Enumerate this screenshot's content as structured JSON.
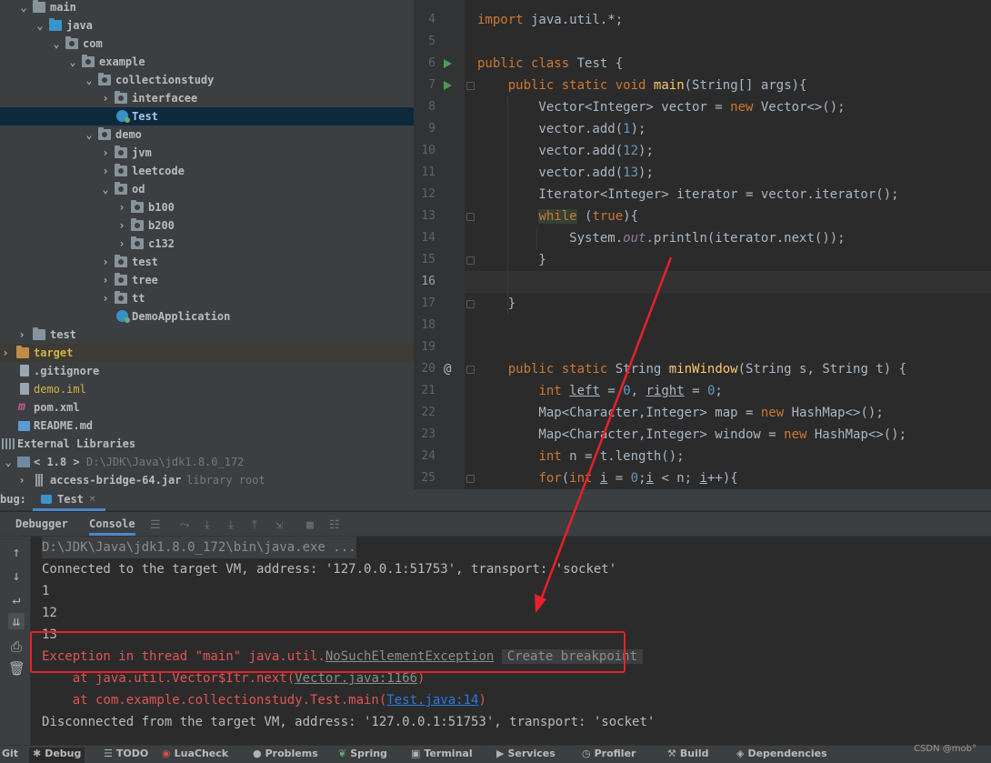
{
  "tree": {
    "rows": [
      {
        "label": "main"
      },
      {
        "label": "java"
      },
      {
        "label": "com"
      },
      {
        "label": "example"
      },
      {
        "label": "collectionstudy"
      },
      {
        "label": "interfacee"
      },
      {
        "label": "Test"
      },
      {
        "label": "demo"
      },
      {
        "label": "jvm"
      },
      {
        "label": "leetcode"
      },
      {
        "label": "od"
      },
      {
        "label": "b100"
      },
      {
        "label": "b200"
      },
      {
        "label": "c132"
      },
      {
        "label": "test"
      },
      {
        "label": "tree"
      },
      {
        "label": "tt"
      },
      {
        "label": "DemoApplication"
      },
      {
        "label": "test"
      },
      {
        "label": "target"
      },
      {
        "label": ".gitignore"
      },
      {
        "label": "demo.iml"
      },
      {
        "label": "pom.xml"
      },
      {
        "label": "README.md"
      },
      {
        "label": "External Libraries"
      },
      {
        "label": "< 1.8 >",
        "hint": "D:\\JDK\\Java\\jdk1.8.0_172"
      },
      {
        "label": "access-bridge-64.jar",
        "hint": "library root"
      }
    ],
    "selected": "Test",
    "excluded_folder": "target"
  },
  "editor": {
    "line_numbers": [
      "4",
      "5",
      "6",
      "7",
      "8",
      "9",
      "10",
      "11",
      "12",
      "13",
      "14",
      "15",
      "16",
      "17",
      "18",
      "19",
      "20",
      "21",
      "22",
      "23",
      "24",
      "25"
    ],
    "current_line": "16",
    "lines": [
      "import java.util.*;",
      "",
      "public class Test {",
      "    public static void main(String[] args){",
      "        Vector<Integer> vector = new Vector<>();",
      "        vector.add(1);",
      "        vector.add(12);",
      "        vector.add(13);",
      "        Iterator<Integer> iterator = vector.iterator();",
      "        while (true){",
      "            System.out.println(iterator.next());",
      "        }",
      "",
      "    }",
      "",
      "",
      "    public static String minWindow(String s, String t) {",
      "        int left = 0, right = 0;",
      "        Map<Character,Integer> map = new HashMap<>();",
      "        Map<Character,Integer> window = new HashMap<>();",
      "        int n = t.length();",
      "        for(int i = 0;i < n; i++){"
    ]
  },
  "debug": {
    "panel_label": "bug:",
    "session_tab": "Test",
    "tabs": {
      "debugger": "Debugger",
      "console": "Console"
    },
    "console_lines": {
      "cmd": "D:\\JDK\\Java\\jdk1.8.0_172\\bin\\java.exe ...",
      "connected": "Connected to the target VM, address: '127.0.0.1:51753', transport: 'socket'",
      "out1": "1",
      "out2": "12",
      "out3": "13",
      "exception_prefix": "Exception in thread \"main\" java.util.",
      "exception_class": "NoSuchElementException",
      "create_breakpoint": "Create breakpoint",
      "trace1_prefix": "    at java.util.Vector$Itr.next(",
      "trace1_link": "Vector.java:1166",
      "trace1_suffix": ")",
      "trace2_prefix": "    at com.example.collectionstudy.Test.main(",
      "trace2_link": "Test.java:14",
      "trace2_suffix": ")",
      "disconnected": "Disconnected from the target VM, address: '127.0.0.1:51753', transport: 'socket'"
    }
  },
  "statusbar": {
    "items": [
      "Git",
      "Debug",
      "TODO",
      "LuaCheck",
      "Problems",
      "Spring",
      "Terminal",
      "Services",
      "Profiler",
      "Build",
      "Dependencies"
    ],
    "watermark": "CSDN @mob°"
  },
  "colors": {
    "annotation_red": "#e8202a",
    "error_text": "#e05555",
    "keyword": "#cc7832",
    "number": "#6897bb"
  }
}
